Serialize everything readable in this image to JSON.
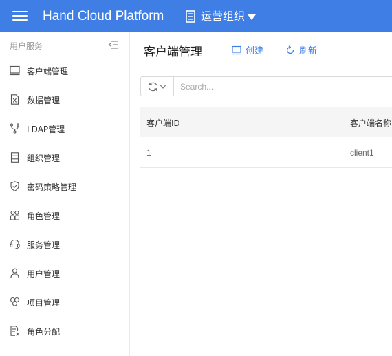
{
  "app": {
    "title": "Hand Cloud Platform"
  },
  "org": {
    "name": "运营组织"
  },
  "sidebar": {
    "section_title": "用户服务",
    "items": [
      {
        "label": "客户端管理",
        "icon": "monitor-icon"
      },
      {
        "label": "数据管理",
        "icon": "excel-file-icon"
      },
      {
        "label": "LDAP管理",
        "icon": "branch-icon"
      },
      {
        "label": "组织管理",
        "icon": "building-icon"
      },
      {
        "label": "密码策略管理",
        "icon": "shield-check-icon"
      },
      {
        "label": "角色管理",
        "icon": "people-icon"
      },
      {
        "label": "服务管理",
        "icon": "headset-icon"
      },
      {
        "label": "用户管理",
        "icon": "user-icon"
      },
      {
        "label": "项目管理",
        "icon": "cluster-icon"
      },
      {
        "label": "角色分配",
        "icon": "role-assign-icon"
      }
    ]
  },
  "page": {
    "title": "客户端管理",
    "create_label": "创建",
    "refresh_label": "刷新"
  },
  "search": {
    "placeholder": "Search...",
    "value": ""
  },
  "table": {
    "columns": [
      "客户端ID",
      "客户端名称"
    ],
    "rows": [
      [
        "1",
        "client1"
      ]
    ]
  },
  "colors": {
    "accent": "#3f7fe5",
    "header_bg": "#3f7fe5",
    "table_head_bg": "#f5f5f5"
  }
}
